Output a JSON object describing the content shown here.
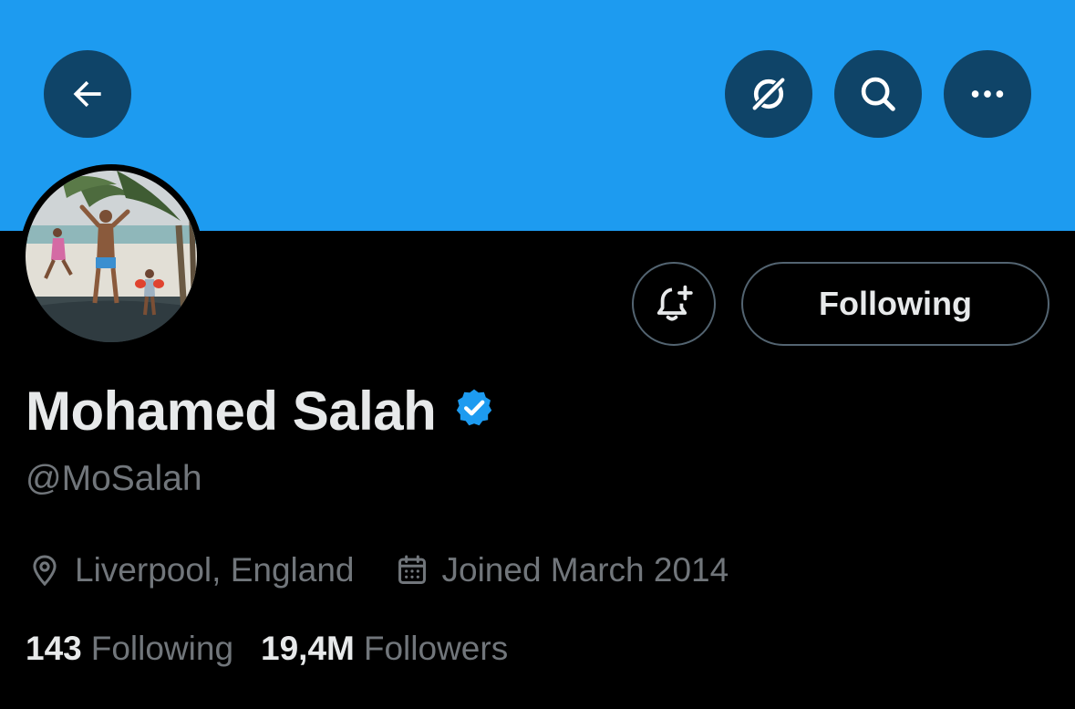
{
  "profile": {
    "name": "Mohamed Salah",
    "handle": "@MoSalah",
    "location": "Liverpool, England",
    "joined": "Joined March 2014",
    "verified": true
  },
  "actions": {
    "follow_label": "Following"
  },
  "stats": {
    "following_count": "143",
    "following_label": "Following",
    "followers_count": "19,4M",
    "followers_label": "Followers"
  },
  "icons": {
    "back": "back-arrow-icon",
    "grok": "grok-icon",
    "search": "search-icon",
    "more": "more-icon",
    "notify": "bell-plus-icon",
    "verified": "verified-badge-icon",
    "location": "location-pin-icon",
    "calendar": "calendar-icon"
  },
  "colors": {
    "banner": "#1d9bf0",
    "background": "#000000",
    "verified": "#1d9bf0",
    "primary_text": "#e7e9ea",
    "secondary_text": "#71767b"
  }
}
